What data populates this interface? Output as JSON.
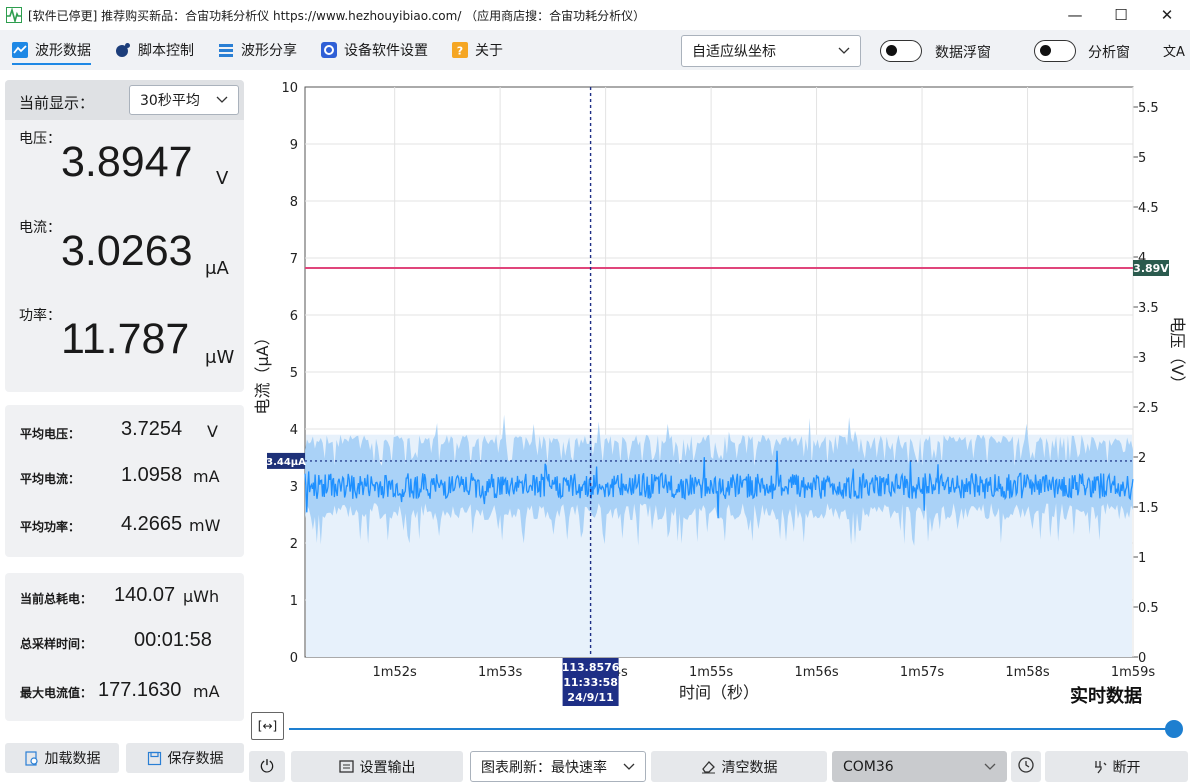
{
  "window": {
    "title": "[软件已停更] 推荐购买新品：合宙功耗分析仪 https://www.hezhouyibiao.com/ （应用商店搜：合宙功耗分析仪）",
    "minimize": "—",
    "maximize": "☐",
    "close": "✕"
  },
  "toolbar": {
    "tabs": [
      {
        "label": "波形数据",
        "icon": "waveform-icon",
        "active": true
      },
      {
        "label": "脚本控制",
        "icon": "script-icon",
        "active": false
      },
      {
        "label": "波形分享",
        "icon": "share-icon",
        "active": false
      },
      {
        "label": "设备软件设置",
        "icon": "gear-icon",
        "active": false
      },
      {
        "label": "关于",
        "icon": "help-icon",
        "active": false
      }
    ],
    "axis_mode": "自适应纵坐标",
    "data_float_label": "数据浮窗",
    "analysis_label": "分析窗",
    "translate_glyph": "文A"
  },
  "left": {
    "display_label": "当前显示：",
    "display_value": "30秒平均",
    "voltage_label": "电压：",
    "voltage_value": "3.8947",
    "voltage_unit": "V",
    "current_label": "电流：",
    "current_value": "3.0263",
    "current_unit": "μA",
    "power_label": "功率：",
    "power_value": "11.787",
    "power_unit": "μW",
    "avg_voltage_label": "平均电压：",
    "avg_voltage_value": "3.7254",
    "avg_voltage_unit": "V",
    "avg_current_label": "平均电流：",
    "avg_current_value": "1.0958",
    "avg_current_unit": "mA",
    "avg_power_label": "平均功率：",
    "avg_power_value": "4.2665",
    "avg_power_unit": "mW",
    "total_energy_label": "当前总耗电：",
    "total_energy_value": "140.07",
    "total_energy_unit": "μWh",
    "sample_time_label": "总采样时间：",
    "sample_time_value": "00:01:58",
    "max_current_label": "最大电流值：",
    "max_current_value": "177.1630",
    "max_current_unit": "mA",
    "load_button": "加载数据",
    "save_button": "保存数据"
  },
  "bottom": {
    "fit_glyph": "[↔]",
    "power_glyph": "⏻",
    "output_button": "设置输出",
    "refresh_label": "图表刷新：最快速率",
    "clear_button": "清空数据",
    "port_value": "COM36",
    "disconnect_button": "断开",
    "slider_fraction": 1.0
  },
  "chart_data": {
    "type": "line",
    "xlabel": "时间（秒）",
    "ylabel": "电流（μA）",
    "y2label": "电压（V）",
    "status_label": "实时数据",
    "x_ticks": [
      "1m52s",
      "1m53s",
      "1m54s",
      "1m55s",
      "1m56s",
      "1m57s",
      "1m58s",
      "1m59s"
    ],
    "x_range_seconds": [
      111.15,
      119
    ],
    "ylim": [
      0,
      10
    ],
    "y_ticks": [
      0,
      1,
      2,
      3,
      4,
      5,
      6,
      7,
      8,
      9,
      10
    ],
    "y2lim": [
      0,
      5.7
    ],
    "y2_ticks": [
      "0",
      "0.5",
      "1",
      "1.5",
      "2",
      "2.5",
      "3",
      "3.5",
      "4",
      "4.5",
      "5",
      "5.5"
    ],
    "series": [
      {
        "name": "电流",
        "color": "#1e90ff",
        "mean": 3.0,
        "band": [
          2.4,
          3.9
        ]
      },
      {
        "name": "电压",
        "color": "#e0457b",
        "value": 3.89
      }
    ],
    "voltage_badge": "3.89V",
    "current_badge": "3.44μA",
    "current_marker": 3.44,
    "cursor": {
      "x_seconds": 113.8576,
      "line1": "113.8576",
      "line2": "11:33:58",
      "line3": "24/9/11"
    }
  }
}
